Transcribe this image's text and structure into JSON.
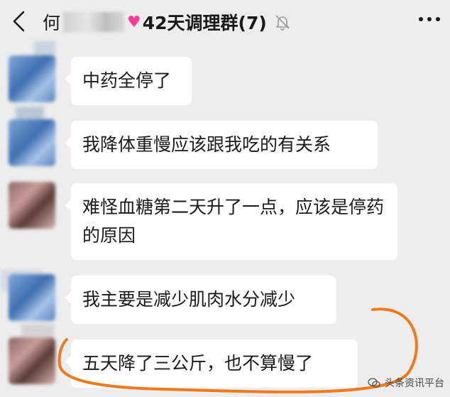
{
  "header": {
    "title_prefix": "何",
    "title_main": "42天调理群(7)",
    "icons": {
      "back": "chevron-left-icon",
      "heart": "heart-icon",
      "mute": "mute-bell-icon",
      "more": "more-icon"
    }
  },
  "messages": [
    {
      "text": "中药全停了"
    },
    {
      "text": "我降体重慢应该跟我吃的有关系"
    },
    {
      "text": "难怪血糖第二天升了一点，应该是停药的原因"
    },
    {
      "text": "我主要是减少肌肉水分减少"
    },
    {
      "text": "五天降了三公斤，也不算慢了"
    }
  ],
  "watermark": {
    "text": "头条资讯平台"
  },
  "colors": {
    "background": "#ededed",
    "bubble": "#ffffff",
    "annotation": "#f07a1a",
    "heart": "#ff3b9a"
  }
}
